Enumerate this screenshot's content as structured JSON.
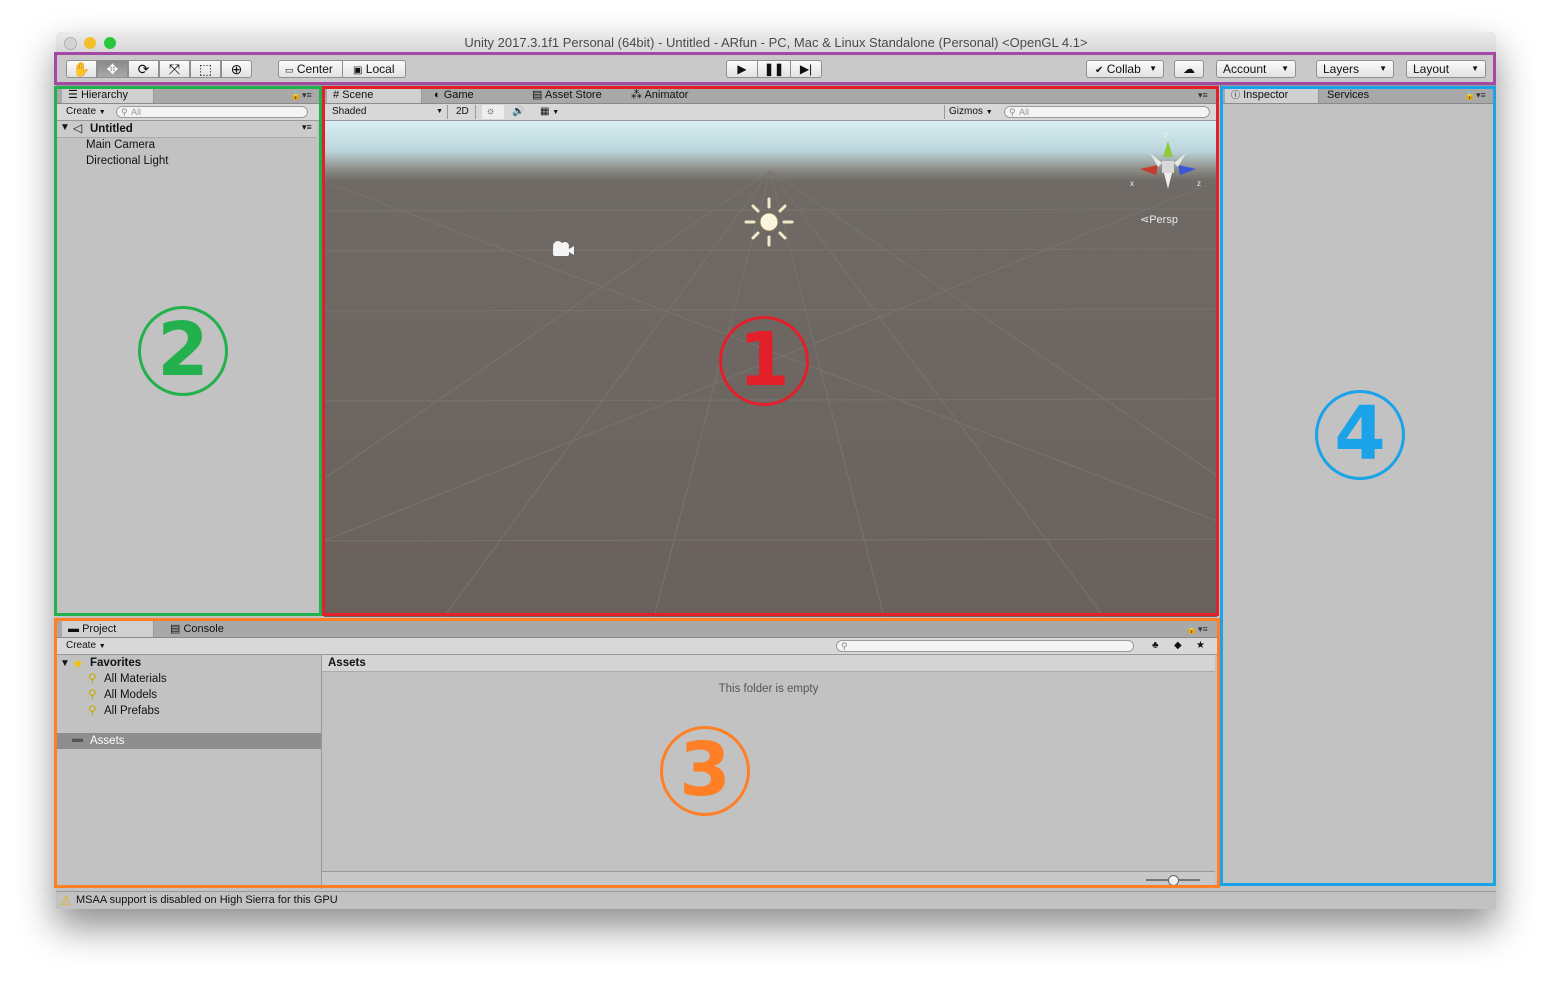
{
  "window": {
    "title": "Unity 2017.3.1f1 Personal (64bit) - Untitled - ARfun - PC, Mac & Linux Standalone (Personal) <OpenGL 4.1>"
  },
  "toolbar": {
    "tools": [
      "hand-icon",
      "move-icon",
      "rotate-icon",
      "scale-icon",
      "rect-icon",
      "transform-icon"
    ],
    "center_label": "Center",
    "local_label": "Local",
    "collab_label": "Collab",
    "account_label": "Account",
    "layers_label": "Layers",
    "layout_label": "Layout"
  },
  "hierarchy": {
    "tab": "Hierarchy",
    "create": "Create",
    "search_placeholder": "All",
    "scene": "Untitled",
    "items": [
      "Main Camera",
      "Directional Light"
    ]
  },
  "scene": {
    "tabs": [
      "Scene",
      "Game",
      "Asset Store",
      "Animator"
    ],
    "shading": "Shaded",
    "mode2d": "2D",
    "gizmos": "Gizmos",
    "search_placeholder": "All",
    "gizmo_axes": {
      "x": "x",
      "y": "y",
      "z": "z"
    },
    "projection": "Persp"
  },
  "inspector": {
    "tabs": [
      "Inspector",
      "Services"
    ]
  },
  "project": {
    "tabs": [
      "Project",
      "Console"
    ],
    "create": "Create",
    "favorites": "Favorites",
    "favorite_items": [
      "All Materials",
      "All Models",
      "All Prefabs"
    ],
    "assets_folder": "Assets",
    "breadcrumb": "Assets",
    "empty_message": "This folder is empty",
    "zoom_level": 0.5
  },
  "status": {
    "message": "MSAA support is disabled on High Sierra for this GPU"
  },
  "annotations": {
    "labels": [
      "①",
      "②",
      "③",
      "④"
    ],
    "colors": {
      "scene": "#e3202a",
      "hierarchy": "#22b14c",
      "project": "#ff7f27",
      "inspector": "#1aa3e8",
      "toolbar": "#a349a4"
    }
  }
}
